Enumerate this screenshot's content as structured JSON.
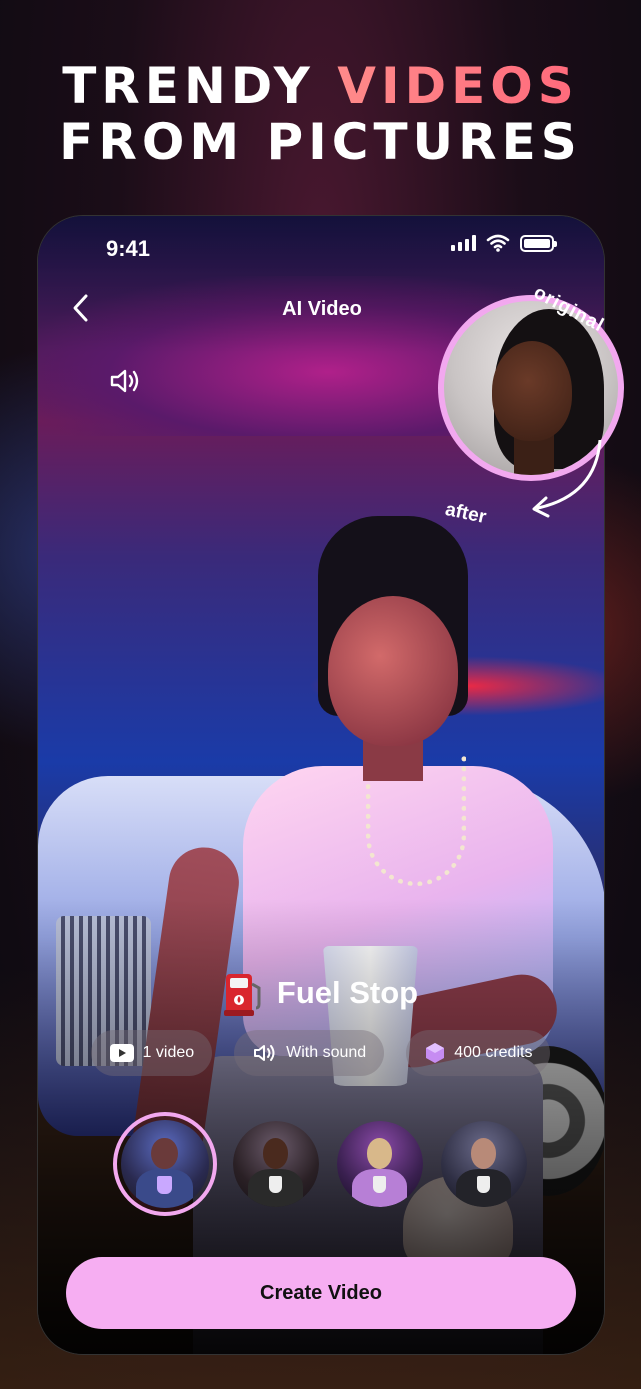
{
  "headline": {
    "line1_part1": "TRENDY ",
    "line1_part2": "VIDEOS",
    "line2": "FROM PICTURES"
  },
  "status_bar": {
    "time": "9:41"
  },
  "header": {
    "title": "AI Video"
  },
  "labels": {
    "original": "original",
    "after": "after"
  },
  "effect": {
    "name": "Fuel Stop"
  },
  "chips": [
    {
      "icon": "video-play-icon",
      "label": "1 video"
    },
    {
      "icon": "speaker-icon",
      "label": "With sound"
    },
    {
      "icon": "gem-icon",
      "label": "400 credits"
    }
  ],
  "thumbnails": [
    {
      "name": "preset-1",
      "selected": true
    },
    {
      "name": "preset-2",
      "selected": false
    },
    {
      "name": "preset-3",
      "selected": false
    },
    {
      "name": "preset-4",
      "selected": false
    }
  ],
  "cta": {
    "label": "Create Video"
  },
  "colors": {
    "accent": "#f6aef2",
    "headline_accent": "#ff6f79"
  }
}
